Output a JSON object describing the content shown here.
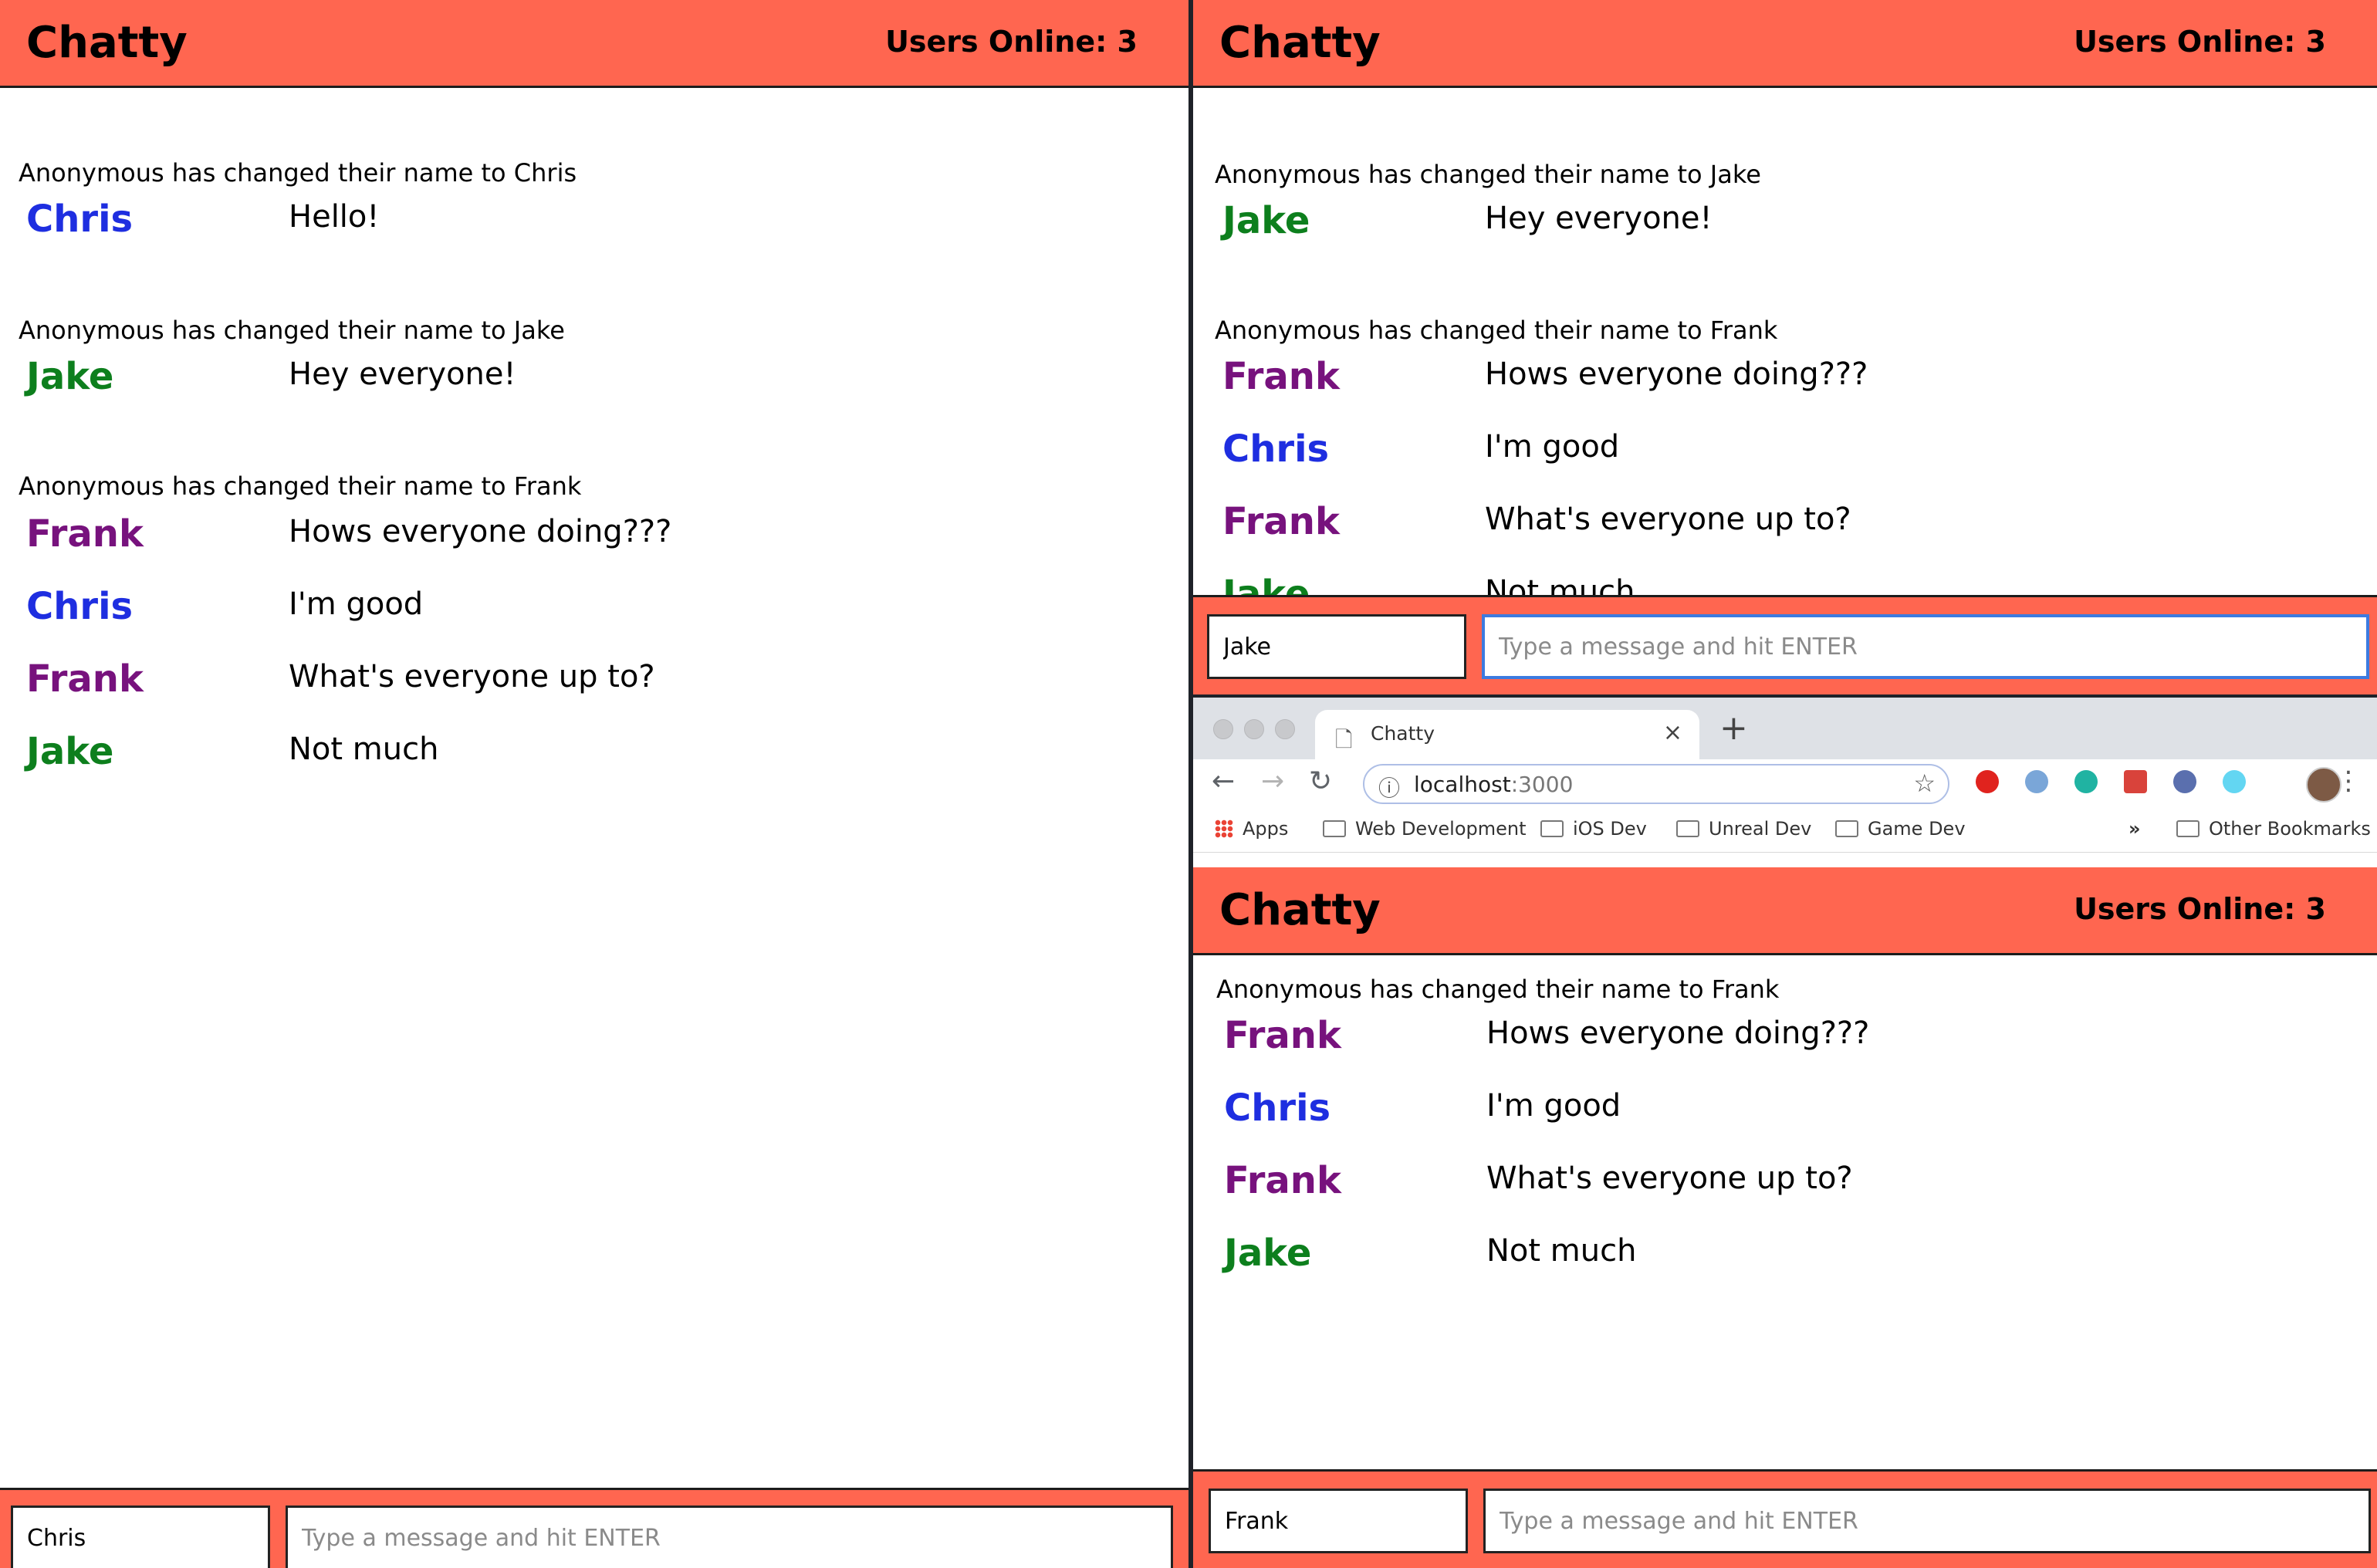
{
  "app": {
    "brand": "Chatty",
    "users_online": "Users Online: 3",
    "placeholder": "Type a message and hit ENTER"
  },
  "colors": {
    "header": "#ff6650",
    "chris": "#1e2ee0",
    "jake": "#0d7f1d",
    "frank": "#77127d"
  },
  "window_a": {
    "username": "Chris",
    "n1": "Anonymous has changed their name to Chris",
    "m1": {
      "user": "Chris",
      "text": "Hello!"
    },
    "n2": "Anonymous has changed their name to Jake",
    "m2": {
      "user": "Jake",
      "text": "Hey everyone!"
    },
    "n3": "Anonymous has changed their name to Frank",
    "m3": {
      "user": "Frank",
      "text": "Hows everyone doing???"
    },
    "m4": {
      "user": "Chris",
      "text": "I'm good"
    },
    "m5": {
      "user": "Frank",
      "text": "What's everyone up to?"
    },
    "m6": {
      "user": "Jake",
      "text": "Not much"
    }
  },
  "window_b": {
    "username": "Jake",
    "n1": "Anonymous has changed their name to Jake",
    "m1": {
      "user": "Jake",
      "text": "Hey everyone!"
    },
    "n2": "Anonymous has changed their name to Frank",
    "m2": {
      "user": "Frank",
      "text": "Hows everyone doing???"
    },
    "m3": {
      "user": "Chris",
      "text": "I'm good"
    },
    "m4": {
      "user": "Frank",
      "text": "What's everyone up to?"
    },
    "m5": {
      "user": "Jake",
      "text": "Not much"
    }
  },
  "window_c": {
    "username": "Frank",
    "browser": {
      "tab_title": "Chatty",
      "url_host": "localhost",
      "url_port": ":3000",
      "bookmarks": [
        "Apps",
        "Web Development",
        "iOS Dev",
        "Unreal Dev",
        "Game Dev"
      ],
      "overflow": "»",
      "other_bookmarks": "Other Bookmarks"
    },
    "n1": "Anonymous has changed their name to Frank",
    "m1": {
      "user": "Frank",
      "text": "Hows everyone doing???"
    },
    "m2": {
      "user": "Chris",
      "text": "I'm good"
    },
    "m3": {
      "user": "Frank",
      "text": "What's everyone up to?"
    },
    "m4": {
      "user": "Jake",
      "text": "Not much"
    }
  }
}
